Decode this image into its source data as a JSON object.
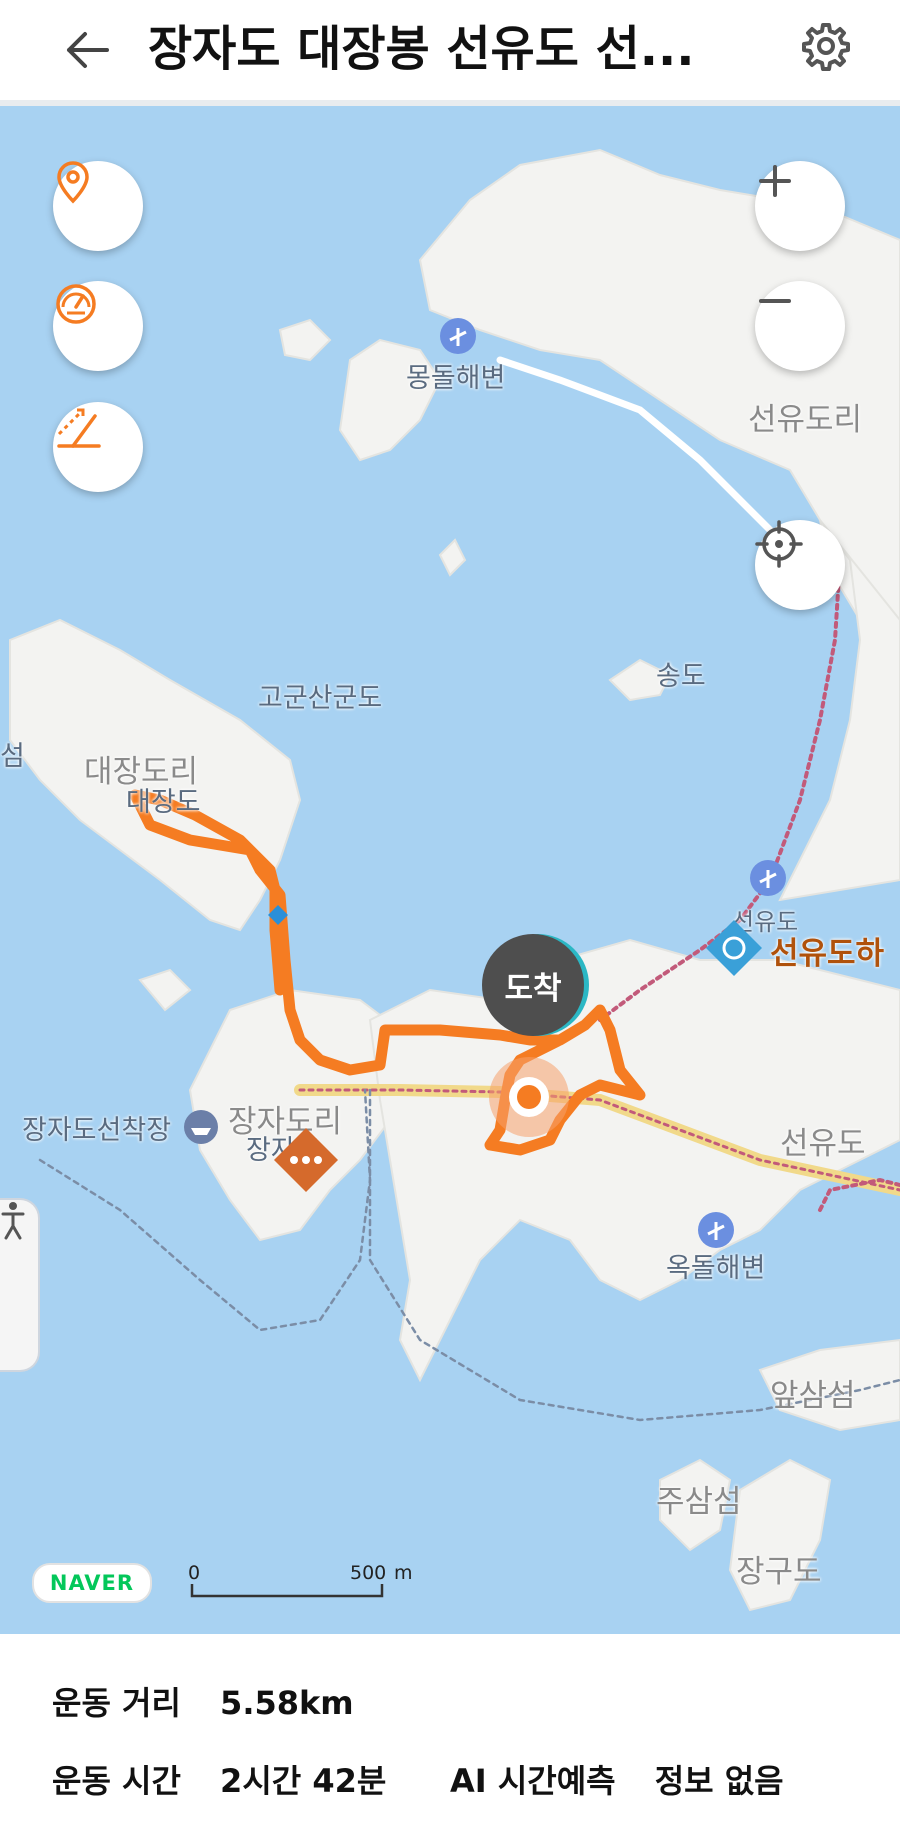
{
  "header": {
    "title": "장자도 대장봉 선유도 선...",
    "back_icon": "arrow-left-icon",
    "settings_icon": "gear-icon"
  },
  "map": {
    "controls_left": [
      "location-pin-icon",
      "speedometer-icon",
      "elevation-icon"
    ],
    "controls_right": [
      "zoom-in-icon",
      "zoom-out-icon",
      "current-location-icon"
    ],
    "labels": {
      "mongdol_beach": "몽돌해변",
      "seonyudo_ri": "선유도리",
      "gogunsangundo": "고군산군도",
      "songdo": "송도",
      "daejangdo_ri": "대장도리",
      "daejangdo": "대장도",
      "seom_partial": "섬",
      "seonyudo_small": "선유도",
      "seonyudo_harbor": "선유도하",
      "jajado_pier": "장자도선착장",
      "jajado_ri": "장자도리",
      "jajado": "장자도",
      "seonyudo": "선유도",
      "okdol_beach": "옥돌해변",
      "apsamseom": "앞삼섬",
      "jusamseom": "주삼섬",
      "janggudo": "장구도"
    },
    "arrival_label": "도착",
    "naver": "NAVER",
    "scale_zero": "0",
    "scale_value": "500",
    "scale_unit": "m",
    "route_color": "#f57c22"
  },
  "stats": {
    "distance_label": "운동 거리",
    "distance_value": "5.58km",
    "time_label": "운동 시간",
    "time_value": "2시간 42분",
    "ai_label": "AI 시간예측",
    "ai_value": "정보 없음"
  }
}
